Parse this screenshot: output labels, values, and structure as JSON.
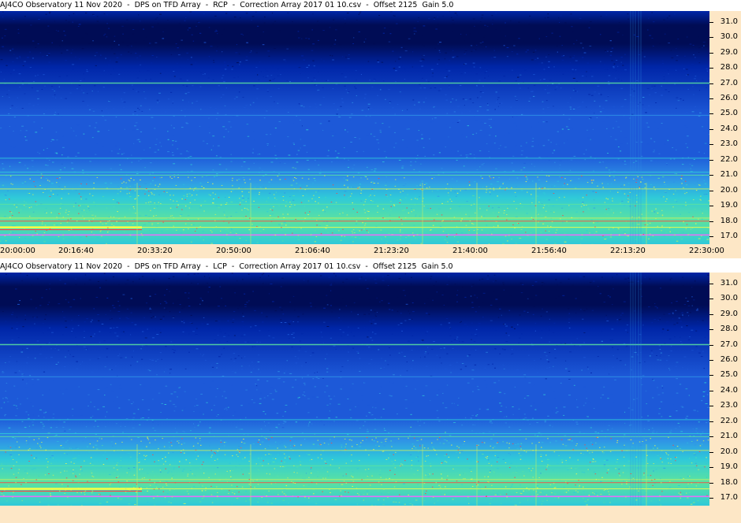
{
  "chart_data": [
    {
      "type": "heatmap",
      "title": "AJ4CO Observatory 11 Nov 2020  -  DPS on TFD Array  -  RCP  -  Correction Array 2017 01 10.csv  -  Offset 2125  Gain 5.0",
      "polarization": "RCP",
      "y_ticks": [
        "31.0",
        "30.0",
        "29.0",
        "28.0",
        "27.0",
        "26.0",
        "25.0",
        "24.0",
        "23.0",
        "22.0",
        "21.0",
        "20.0",
        "19.0",
        "18.0",
        "17.0"
      ],
      "ylim": [
        16.5,
        31.7
      ],
      "x_ticks": [
        "20:00:00",
        "20:16:40",
        "20:33:20",
        "20:50:00",
        "21:06:40",
        "21:23:20",
        "21:40:00",
        "21:56:40",
        "22:13:20",
        "22:30:00"
      ],
      "xlim": [
        "20:00:00",
        "22:30:00"
      ],
      "colormap": [
        "#000c55",
        "#0026a8",
        "#1d59d8",
        "#2f93e6",
        "#2fc9d9",
        "#5be3a0",
        "#c8f060",
        "#ffff40",
        "#ff4040",
        "#ff60ff"
      ],
      "interference_lines_mhz": [
        17.1,
        17.6,
        18.0,
        18.2,
        19.1,
        20.1,
        21.0,
        21.2,
        22.1,
        24.9,
        27.0
      ]
    },
    {
      "type": "heatmap",
      "title": "AJ4CO Observatory 11 Nov 2020  -  DPS on TFD Array  -  LCP  -  Correction Array 2017 01 10.csv  -  Offset 2125  Gain 5.0",
      "polarization": "LCP",
      "y_ticks": [
        "31.0",
        "30.0",
        "29.0",
        "28.0",
        "27.0",
        "26.0",
        "25.0",
        "24.0",
        "23.0",
        "22.0",
        "21.0",
        "20.0",
        "19.0",
        "18.0",
        "17.0"
      ],
      "ylim": [
        16.5,
        31.7
      ],
      "colormap": [
        "#000c55",
        "#0026a8",
        "#1d59d8",
        "#2f93e6",
        "#2fc9d9",
        "#5be3a0",
        "#c8f060",
        "#ffff40",
        "#ff4040",
        "#ff60ff"
      ],
      "interference_lines_mhz": [
        17.1,
        17.6,
        18.0,
        18.2,
        19.1,
        20.1,
        21.0,
        21.2,
        22.1,
        24.9,
        27.0
      ]
    }
  ]
}
